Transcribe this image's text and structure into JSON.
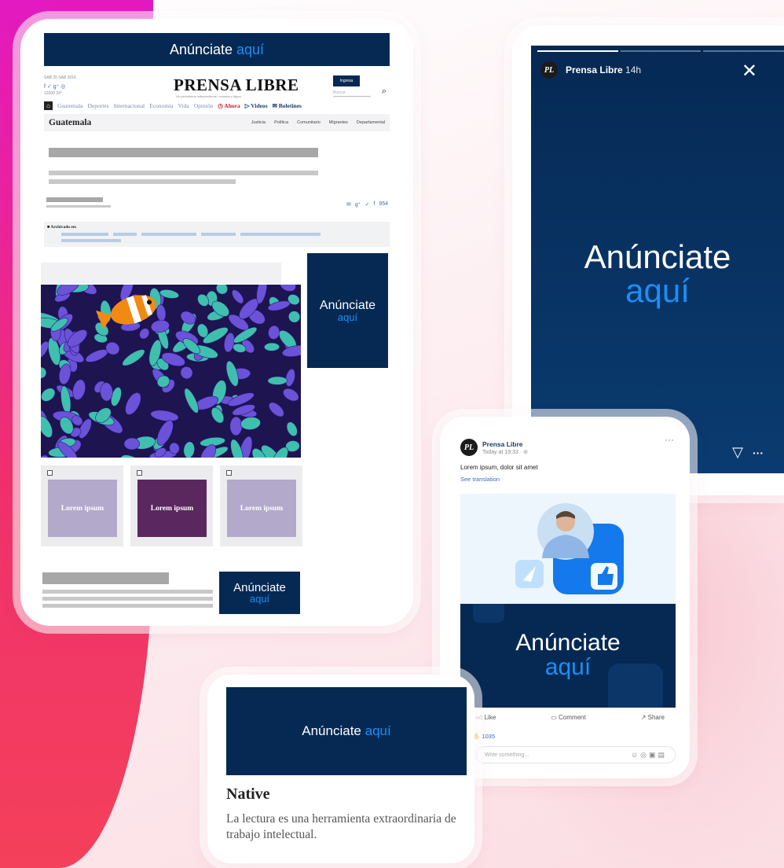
{
  "ad": {
    "word1": "Anúnciate",
    "word2": "aquí"
  },
  "desktop": {
    "masthead": {
      "date": "SAB 25 SAB 2016",
      "temp_line": "12000 33°",
      "logo": "PRENSA LIBRE",
      "tagline": "Un periodismo independiente, honrado y digno",
      "login_button": "Ingresa",
      "search_placeholder": "Buscar"
    },
    "nav": {
      "items": [
        "Guatemala",
        "Deportes",
        "Internacional",
        "Economía",
        "Vida",
        "Opinión"
      ],
      "ahora": "Ahora",
      "videos": "Videos",
      "boletines": "Boletines"
    },
    "section": {
      "title": "Guatemala",
      "links": [
        "Justicia",
        "Política",
        "Comunitario",
        "Migrantes",
        "Departamental"
      ]
    },
    "share_count": "954",
    "archivado_label": "Archivado en:",
    "cards": [
      {
        "label": "Lorem ipsum",
        "color": "#b3a9cb"
      },
      {
        "label": "Lorem ipsum",
        "color": "#5b275f"
      },
      {
        "label": "Lorem ipsum",
        "color": "#b3a9cb"
      }
    ]
  },
  "story": {
    "page_name": "Prensa Libre",
    "time": "14h",
    "avatar": "PL"
  },
  "facebook": {
    "page_name": "Prensa Libre",
    "time": "Today at 19:33 · ",
    "post_text": "Lorem ipsum, dolor sit amet",
    "see_translation": "See translation",
    "actions": {
      "like": "Like",
      "comment": "Comment",
      "share": "Share"
    },
    "reaction_count": "1035",
    "comment_placeholder": "Write something..."
  },
  "native": {
    "title": "Native",
    "body": "La lectura es una herramienta extraordinaria de trabajo intelectual."
  },
  "colors": {
    "navy": "#062954",
    "accent_blue": "#1e8ef3",
    "magenta": "#e31ac0",
    "pink": "#f4405a"
  }
}
